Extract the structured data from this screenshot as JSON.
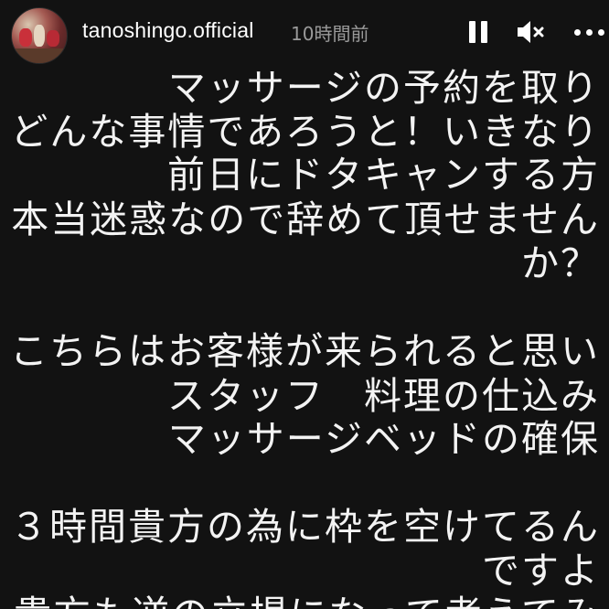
{
  "header": {
    "username": "tanoshingo.official",
    "time": "10時間前",
    "avatar_icon": "profile-photo-group",
    "pause_icon": "pause-icon",
    "mute_icon": "volume-muted-icon",
    "more_icon": "more-dots-icon"
  },
  "message": {
    "lines": [
      "マッサージの予約を取り",
      "どんな事情であろうと！いきなり",
      "前日にドタキャンする方",
      "本当迷惑なので辞めて頂せません",
      "か？",
      "",
      "こちらはお客様が来られると思い",
      "スタッフ　料理の仕込み",
      "マッサージベッドの確保",
      "",
      "３時間貴方の為に枠を空けてるん",
      "ですよ",
      "貴方も逆の立場になって考えてみ"
    ]
  },
  "colors": {
    "background": "#121212",
    "text": "#f3f3f3",
    "time": "#9a9a9a"
  }
}
